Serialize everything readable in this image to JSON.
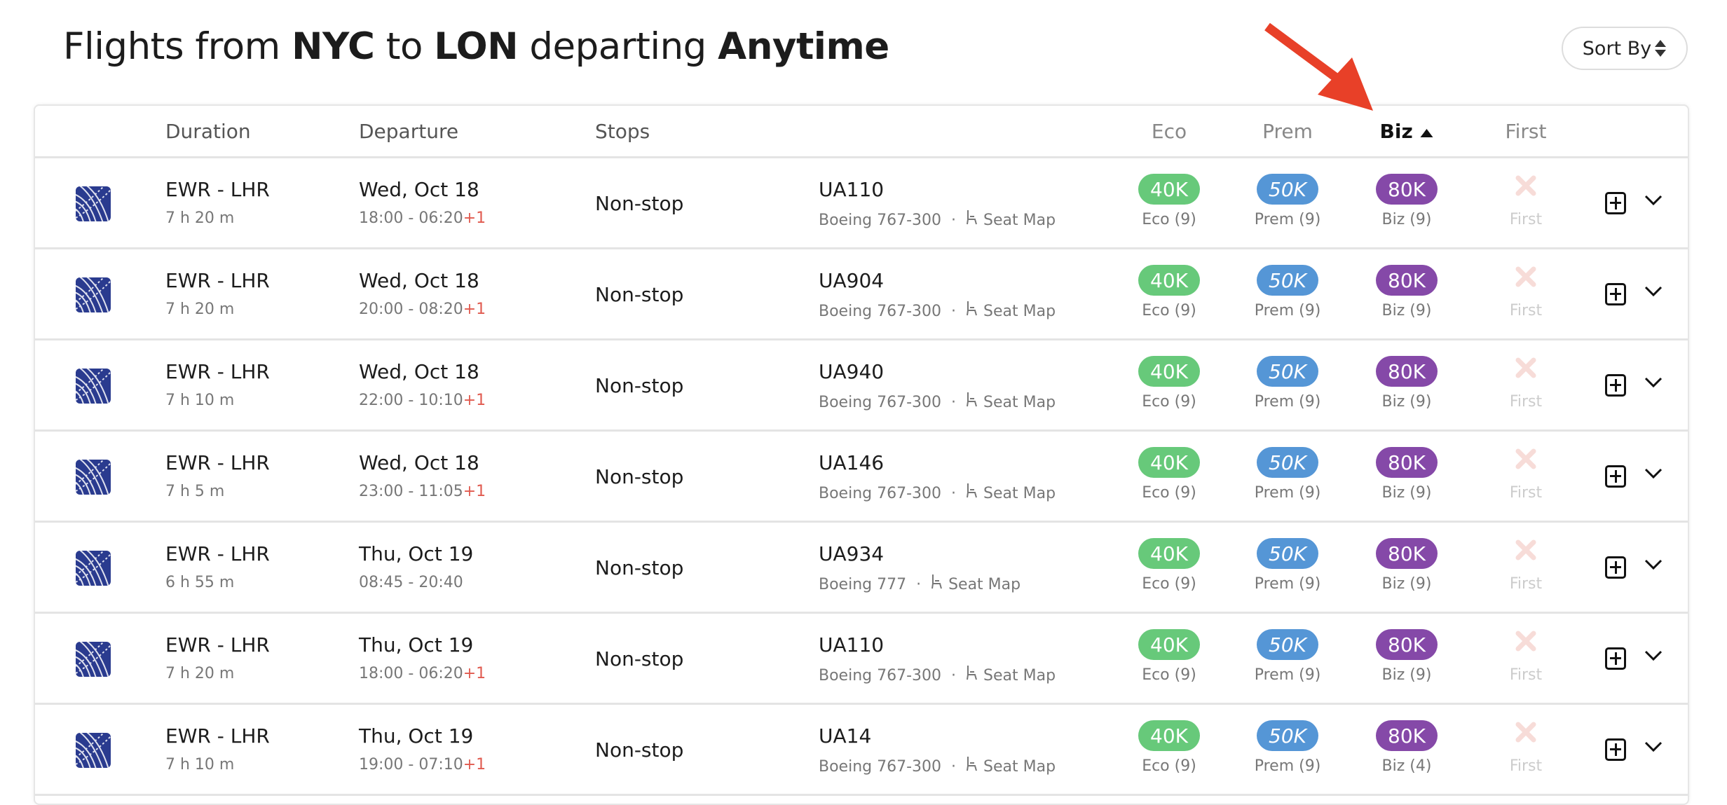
{
  "header": {
    "title_parts": [
      "Flights from ",
      "NYC",
      " to ",
      "LON",
      " departing ",
      "Anytime"
    ],
    "sort_label": "Sort By"
  },
  "columns": {
    "duration": "Duration",
    "departure": "Departure",
    "stops": "Stops",
    "eco": "Eco",
    "prem": "Prem",
    "biz": "Biz",
    "first": "First",
    "sorted_column": "biz",
    "sort_direction": "ascending"
  },
  "colors": {
    "eco": "#67c97a",
    "prem": "#5596d6",
    "biz": "#8549a8",
    "first_unavailable": "#f7dcd8",
    "airline_logo": "#2a3b8f",
    "next_day": "#e05a4f",
    "annotation_arrow": "#e84028"
  },
  "rows": [
    {
      "route": "EWR - LHR",
      "duration": "7 h 20 m",
      "date": "Wed, Oct 18",
      "times": "18:00 - 06:20",
      "next_day": "+1",
      "stops": "Non-stop",
      "flight": "UA110",
      "aircraft": "Boeing 767-300",
      "seat_map": "Seat Map",
      "eco": "40K",
      "eco_label": "Eco (9)",
      "prem": "50K",
      "prem_label": "Prem (9)",
      "biz": "80K",
      "biz_label": "Biz (9)",
      "first_label": "First"
    },
    {
      "route": "EWR - LHR",
      "duration": "7 h 20 m",
      "date": "Wed, Oct 18",
      "times": "20:00 - 08:20",
      "next_day": "+1",
      "stops": "Non-stop",
      "flight": "UA904",
      "aircraft": "Boeing 767-300",
      "seat_map": "Seat Map",
      "eco": "40K",
      "eco_label": "Eco (9)",
      "prem": "50K",
      "prem_label": "Prem (9)",
      "biz": "80K",
      "biz_label": "Biz (9)",
      "first_label": "First"
    },
    {
      "route": "EWR - LHR",
      "duration": "7 h 10 m",
      "date": "Wed, Oct 18",
      "times": "22:00 - 10:10",
      "next_day": "+1",
      "stops": "Non-stop",
      "flight": "UA940",
      "aircraft": "Boeing 767-300",
      "seat_map": "Seat Map",
      "eco": "40K",
      "eco_label": "Eco (9)",
      "prem": "50K",
      "prem_label": "Prem (9)",
      "biz": "80K",
      "biz_label": "Biz (9)",
      "first_label": "First"
    },
    {
      "route": "EWR - LHR",
      "duration": "7 h 5 m",
      "date": "Wed, Oct 18",
      "times": "23:00 - 11:05",
      "next_day": "+1",
      "stops": "Non-stop",
      "flight": "UA146",
      "aircraft": "Boeing 767-300",
      "seat_map": "Seat Map",
      "eco": "40K",
      "eco_label": "Eco (9)",
      "prem": "50K",
      "prem_label": "Prem (9)",
      "biz": "80K",
      "biz_label": "Biz (9)",
      "first_label": "First"
    },
    {
      "route": "EWR - LHR",
      "duration": "6 h 55 m",
      "date": "Thu, Oct 19",
      "times": "08:45 - 20:40",
      "next_day": "",
      "stops": "Non-stop",
      "flight": "UA934",
      "aircraft": "Boeing 777",
      "seat_map": "Seat Map",
      "eco": "40K",
      "eco_label": "Eco (9)",
      "prem": "50K",
      "prem_label": "Prem (9)",
      "biz": "80K",
      "biz_label": "Biz (9)",
      "first_label": "First"
    },
    {
      "route": "EWR - LHR",
      "duration": "7 h 20 m",
      "date": "Thu, Oct 19",
      "times": "18:00 - 06:20",
      "next_day": "+1",
      "stops": "Non-stop",
      "flight": "UA110",
      "aircraft": "Boeing 767-300",
      "seat_map": "Seat Map",
      "eco": "40K",
      "eco_label": "Eco (9)",
      "prem": "50K",
      "prem_label": "Prem (9)",
      "biz": "80K",
      "biz_label": "Biz (9)",
      "first_label": "First"
    },
    {
      "route": "EWR - LHR",
      "duration": "7 h 10 m",
      "date": "Thu, Oct 19",
      "times": "19:00 - 07:10",
      "next_day": "+1",
      "stops": "Non-stop",
      "flight": "UA14",
      "aircraft": "Boeing 767-300",
      "seat_map": "Seat Map",
      "eco": "40K",
      "eco_label": "Eco (9)",
      "prem": "50K",
      "prem_label": "Prem (9)",
      "biz": "80K",
      "biz_label": "Biz (4)",
      "first_label": "First"
    }
  ]
}
